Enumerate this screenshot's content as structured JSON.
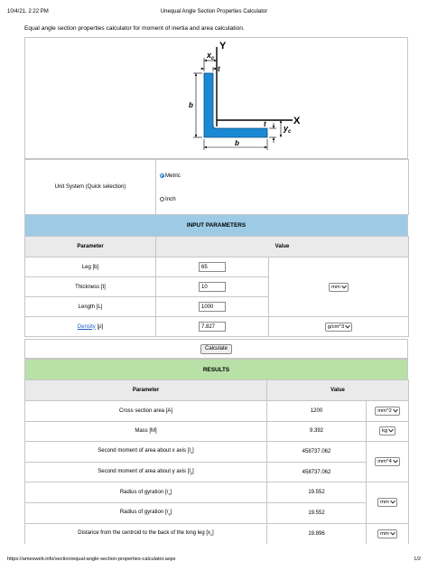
{
  "header": {
    "datetime": "10/4/21, 2:22 PM",
    "page_title": "Unequal Angle Section Properties Calculator"
  },
  "intro": "Equal angle section properties calculator for moment of inertia and area calculation.",
  "figure": {
    "label_y": "Y",
    "label_x": "X",
    "label_xc": "x",
    "label_xc_sub": "c",
    "label_yc": "y",
    "label_yc_sub": "c",
    "label_t": "t",
    "label_b": "b",
    "section_color": "#1a8ad4"
  },
  "unit_system": {
    "label": "Unit System (Quick selection)",
    "options": [
      "Metric",
      "Inch"
    ],
    "selected": "Metric"
  },
  "input": {
    "band": "INPUT PARAMETERS",
    "col_parameter": "Parameter",
    "col_value": "Value",
    "leg_label": "Leg [b]",
    "leg_value": "65",
    "thickness_label": "Thickness [t]",
    "thickness_value": "10",
    "length_label": "Length [L]",
    "length_value": "1000",
    "length_unit": "mm",
    "density_link": "Density",
    "density_symbol": " [ρ]",
    "density_value": "7.827",
    "density_unit": "g/cm^3"
  },
  "calculate_label": "Calculate",
  "results": {
    "band": "RESULTS",
    "col_parameter": "Parameter",
    "col_value": "Value",
    "area_label": "Cross section area [A]",
    "area_value": "1200",
    "area_unit": "mm^2",
    "mass_label": "Mass [M]",
    "mass_value": "9.392",
    "mass_unit": "kg",
    "ix_label": "Second moment of area about x axis [I",
    "ix_sub": "x",
    "ix_value": "458737.062",
    "iy_label": "Second moment of area about y axis [I",
    "iy_sub": "y",
    "iy_value": "458737.062",
    "inertia_unit": "mm^4",
    "rx_label": "Radius of gyration [r",
    "rx_sub": "x",
    "rx_value": "19.552",
    "ry_label": "Radius of gyration [r",
    "ry_sub": "y",
    "ry_value": "19.552",
    "gyration_unit": "mm",
    "xc_label": "Distance from the centroid to the back of the long leg [x",
    "xc_sub": "c",
    "xc_value": "19.896",
    "xc_unit": "mm"
  },
  "footer": {
    "url": "https://amesweb.info/section/equal-angle-section-properties-calculator.aspx",
    "page": "1/2"
  }
}
